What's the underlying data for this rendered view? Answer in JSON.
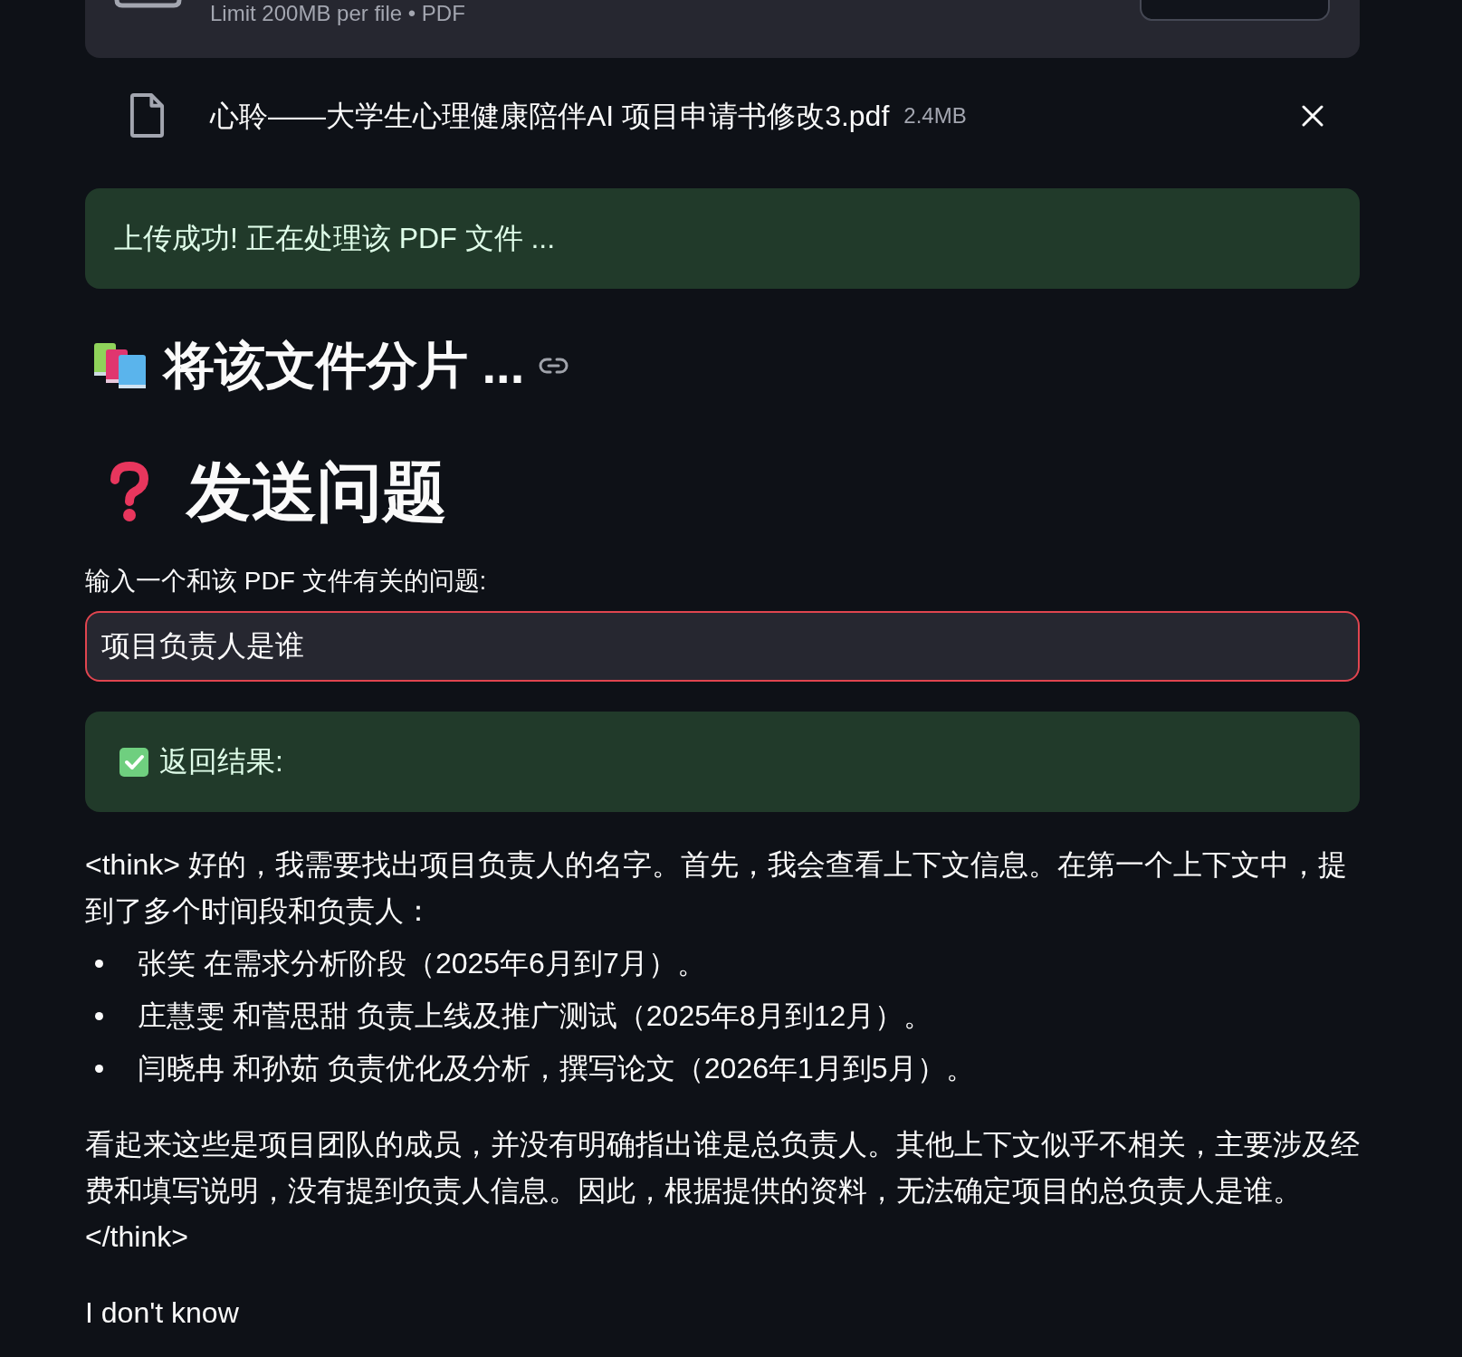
{
  "uploader": {
    "note": "Limit 200MB per file • PDF"
  },
  "file": {
    "name": "心聆——大学生心理健康陪伴AI 项目申请书修改3.pdf",
    "size": "2.4MB"
  },
  "status_message": {
    "kind": "success",
    "text": "上传成功! 正在处理该 PDF 文件 ..."
  },
  "split_heading": {
    "text": "将该文件分片 ..."
  },
  "question_heading": {
    "text": "发送问题"
  },
  "question": {
    "label": "输入一个和该 PDF 文件有关的问题:",
    "value": "项目负责人是谁",
    "focused": true
  },
  "result_message": {
    "kind": "success",
    "text": "返回结果:"
  },
  "answer": [
    {
      "kind": "paragraph",
      "text": "<think> 好的，我需要找出项目负责人的名字。首先，我会查看上下文信息。在第一个上下文中，提到了多个时间段和负责人："
    },
    {
      "kind": "list",
      "items": [
        "张笑 在需求分析阶段（2025年6月到7月）。",
        "庄慧雯 和菅思甜 负责上线及推广测试（2025年8月到12月）。",
        "闫晓冉 和孙茹 负责优化及分析，撰写论文（2026年1月到5月）。"
      ]
    },
    {
      "kind": "paragraph",
      "text": "看起来这些是项目团队的成员，并没有明确指出谁是总负责人。其他上下文似乎不相关，主要涉及经费和填写说明，没有提到负责人信息。因此，根据提供的资料，无法确定项目的总负责人是谁。\n</think>"
    },
    {
      "kind": "paragraph",
      "text": "I don't know"
    }
  ]
}
